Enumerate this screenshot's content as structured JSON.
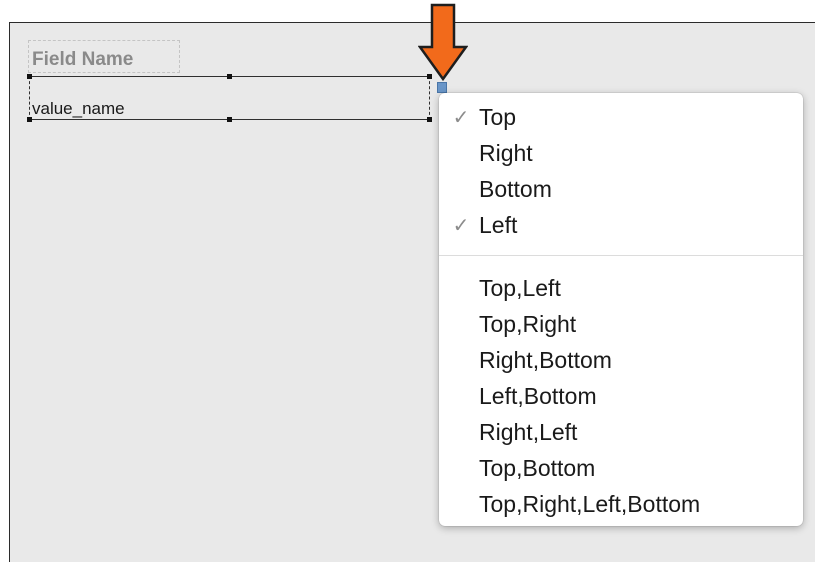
{
  "field": {
    "label": "Field Name",
    "value": "value_name"
  },
  "anchor_menu": {
    "sides": [
      {
        "label": "Top",
        "checked": true
      },
      {
        "label": "Right",
        "checked": false
      },
      {
        "label": "Bottom",
        "checked": false
      },
      {
        "label": "Left",
        "checked": true
      }
    ],
    "combinations": [
      {
        "label": "Top,Left"
      },
      {
        "label": "Top,Right"
      },
      {
        "label": "Right,Bottom"
      },
      {
        "label": "Left,Bottom"
      },
      {
        "label": "Right,Left"
      },
      {
        "label": "Top,Bottom"
      },
      {
        "label": "Top,Right,Left,Bottom"
      }
    ],
    "check_glyph": "✓"
  },
  "colors": {
    "arrow": "#f26a1b",
    "anchor_button": "#6a96c8",
    "canvas": "#e9e9e9"
  },
  "icons": {
    "pointer": "down-arrow-icon",
    "anchor": "anchor-button-icon"
  }
}
